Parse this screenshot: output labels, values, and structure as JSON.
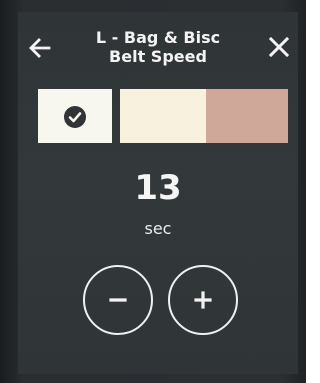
{
  "header": {
    "title_line1": "L - Bag & Bisc",
    "title_line2": "Belt Speed"
  },
  "icons": {
    "back": "arrow-left-icon",
    "close": "close-icon",
    "check": "check-circle-icon",
    "decrement": "minus-icon",
    "increment": "plus-icon"
  },
  "swatches": [
    {
      "name": "swatch-light",
      "color": "#f7f6ef",
      "selected": true
    },
    {
      "name": "swatch-cream",
      "color": "#f8f1de",
      "selected": false
    },
    {
      "name": "swatch-tan",
      "color": "#cfa89a",
      "selected": false
    }
  ],
  "setting": {
    "value": "13",
    "unit": "sec"
  },
  "colors": {
    "screen_background": "#33393b",
    "foreground": "#f3f3f3"
  }
}
